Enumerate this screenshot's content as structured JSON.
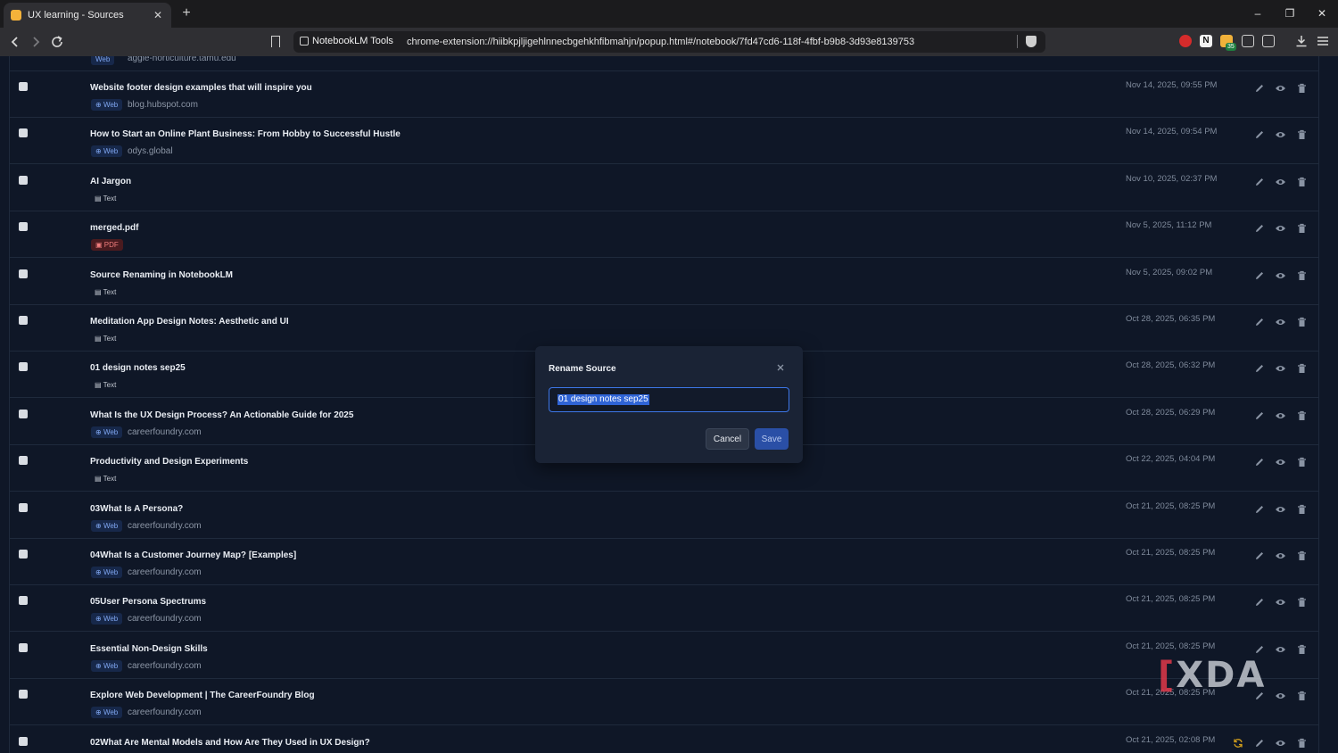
{
  "browser": {
    "tab_title": "UX learning - Sources",
    "tab_close": "✕",
    "new_tab": "+",
    "extension_label": "NotebookLM Tools",
    "url": "chrome-extension://hiibkpjljigehlnnecbgehkhfibmahjn/popup.html#/notebook/7fd47cd6-118f-4fbf-b9b8-3d93e8139753",
    "extension_badge": "35",
    "ext_n": "N",
    "window_controls": [
      "–",
      "❐",
      "✕"
    ]
  },
  "partial_row": {
    "domain": "aggie-horticulture.tamu.edu",
    "type": "Web"
  },
  "sources": [
    {
      "title": "Website footer design examples that will inspire you",
      "type": "Web",
      "domain": "blog.hubspot.com",
      "date": "Nov 14, 2025, 09:55 PM"
    },
    {
      "title": "How to Start an Online Plant Business: From Hobby to Successful Hustle",
      "type": "Web",
      "domain": "odys.global",
      "date": "Nov 14, 2025, 09:54 PM"
    },
    {
      "title": "AI Jargon",
      "type": "Text",
      "domain": "",
      "date": "Nov 10, 2025, 02:37 PM"
    },
    {
      "title": "merged.pdf",
      "type": "PDF",
      "domain": "",
      "date": "Nov 5, 2025, 11:12 PM"
    },
    {
      "title": "Source Renaming in NotebookLM",
      "type": "Text",
      "domain": "",
      "date": "Nov 5, 2025, 09:02 PM"
    },
    {
      "title": "Meditation App Design Notes: Aesthetic and UI",
      "type": "Text",
      "domain": "",
      "date": "Oct 28, 2025, 06:35 PM"
    },
    {
      "title": "01 design notes sep25",
      "type": "Text",
      "domain": "",
      "date": "Oct 28, 2025, 06:32 PM"
    },
    {
      "title": "What Is the UX Design Process? An Actionable Guide for 2025",
      "type": "Web",
      "domain": "careerfoundry.com",
      "date": "Oct 28, 2025, 06:29 PM"
    },
    {
      "title": "Productivity and Design Experiments",
      "type": "Text",
      "domain": "",
      "date": "Oct 22, 2025, 04:04 PM"
    },
    {
      "title": "03What Is A Persona?",
      "type": "Web",
      "domain": "careerfoundry.com",
      "date": "Oct 21, 2025, 08:25 PM"
    },
    {
      "title": "04What Is a Customer Journey Map? [Examples]",
      "type": "Web",
      "domain": "careerfoundry.com",
      "date": "Oct 21, 2025, 08:25 PM"
    },
    {
      "title": "05User Persona Spectrums",
      "type": "Web",
      "domain": "careerfoundry.com",
      "date": "Oct 21, 2025, 08:25 PM"
    },
    {
      "title": "Essential Non-Design Skills",
      "type": "Web",
      "domain": "careerfoundry.com",
      "date": "Oct 21, 2025, 08:25 PM"
    },
    {
      "title": "Explore Web Development | The CareerFoundry Blog",
      "type": "Web",
      "domain": "careerfoundry.com",
      "date": "Oct 21, 2025, 08:25 PM"
    },
    {
      "title": "02What Are Mental Models and How Are They Used in UX Design?",
      "type": "Web",
      "domain": "",
      "date": "Oct 21, 2025, 02:08 PM",
      "syncing": true
    }
  ],
  "modal": {
    "title": "Rename Source",
    "input_value": "01 design notes sep25",
    "cancel_label": "Cancel",
    "save_label": "Save"
  },
  "icons": {
    "back": "back-icon",
    "forward": "forward-icon",
    "reload": "reload-icon",
    "edit": "pencil-icon",
    "view": "eye-icon",
    "delete": "trash-icon",
    "sync": "sync-icon"
  },
  "watermark": {
    "bracket": "[",
    "text": "XDA"
  },
  "colors": {
    "background": "#0f1727",
    "accent": "#3d77e8",
    "web_chip": "#7fa6f0",
    "pdf_chip": "#f07d7d",
    "sync": "#d4a01c"
  }
}
